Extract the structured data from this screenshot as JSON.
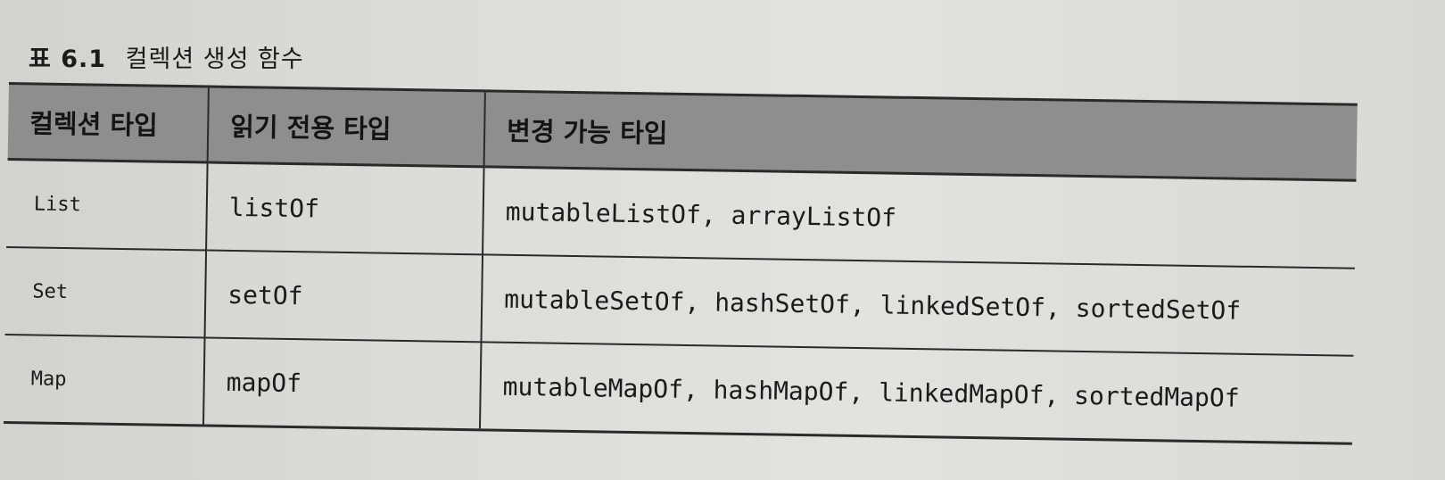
{
  "caption": {
    "number": "표 6.1",
    "title": "컬렉션 생성 함수"
  },
  "table": {
    "headers": [
      "컬렉션 타입",
      "읽기 전용 타입",
      "변경 가능 타입"
    ],
    "rows": [
      [
        "List",
        "listOf",
        "mutableListOf, arrayListOf"
      ],
      [
        "Set",
        "setOf",
        "mutableSetOf, hashSetOf, linkedSetOf, sortedSetOf"
      ],
      [
        "Map",
        "mapOf",
        "mutableMapOf, hashMapOf, linkedMapOf, sortedMapOf"
      ]
    ]
  }
}
